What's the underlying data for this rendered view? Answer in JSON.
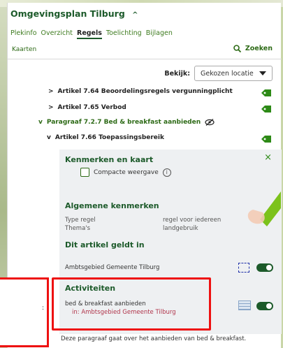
{
  "header": {
    "title": "Omgevingsplan Tilburg",
    "chevron": "^"
  },
  "tabs": [
    {
      "label": "Plekinfo",
      "active": false
    },
    {
      "label": "Overzicht",
      "active": false
    },
    {
      "label": "Regels",
      "active": true
    },
    {
      "label": "Toelichting",
      "active": false
    },
    {
      "label": "Bijlagen",
      "active": false
    }
  ],
  "links": {
    "kaarten": "Kaarten",
    "zoeken": "Zoeken"
  },
  "bekijk": {
    "label": "Bekijk:",
    "selected": "Gekozen locatie"
  },
  "tree": [
    {
      "label": "Artikel 7.64 Beoordelingsregels vergunningplicht",
      "chevron": ">"
    },
    {
      "label": "Artikel 7.65 Verbod",
      "chevron": ">"
    },
    {
      "label": "Paragraaf 7.2.7 Bed & breakfast aanbieden",
      "chevron": "v"
    },
    {
      "label": "Artikel 7.66 Toepassingsbereik",
      "chevron": "v"
    }
  ],
  "details": {
    "title": "Kenmerken en kaart",
    "close": "×",
    "compact_label": "Compacte weergave",
    "info": "i",
    "general_title": "Algemene kenmerken",
    "type_label": "Type regel",
    "type_value": "regel voor iedereen",
    "themes_label": "Thema's",
    "themes_value": "landgebruik",
    "applies_title": "Dit artikel geldt in",
    "applies_value": "Ambtsgebied Gemeente Tilburg",
    "activities_title": "Activiteiten",
    "activity_value": "bed & breakfast aanbieden",
    "activity_location": "in: Ambtsgebied Gemeente Tilburg"
  },
  "left_callout": ":",
  "footer": "Deze paragraaf gaat over het aanbieden van bed & breakfast.",
  "colors": {
    "brand_green": "#1c5a2a",
    "accent_green": "#2d8a16",
    "highlight_red": "#e11111",
    "location_text": "#b0344a"
  }
}
